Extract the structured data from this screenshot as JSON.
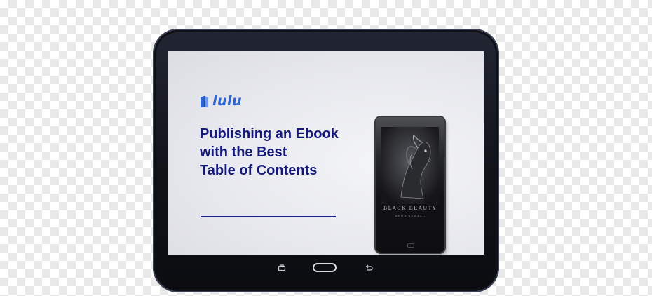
{
  "logo": {
    "text": "lulu",
    "color": "#2f66d0"
  },
  "headline": {
    "lines": [
      "Publishing an Ebook",
      "with the Best",
      "Table of Contents"
    ],
    "color": "#14197a"
  },
  "book": {
    "title": "BLACK BEAUTY",
    "author": "ANNA SEWELL"
  },
  "device": {
    "buttons": [
      "recent-apps-icon",
      "home-button",
      "back-icon"
    ],
    "bezel_color": "#111319"
  }
}
